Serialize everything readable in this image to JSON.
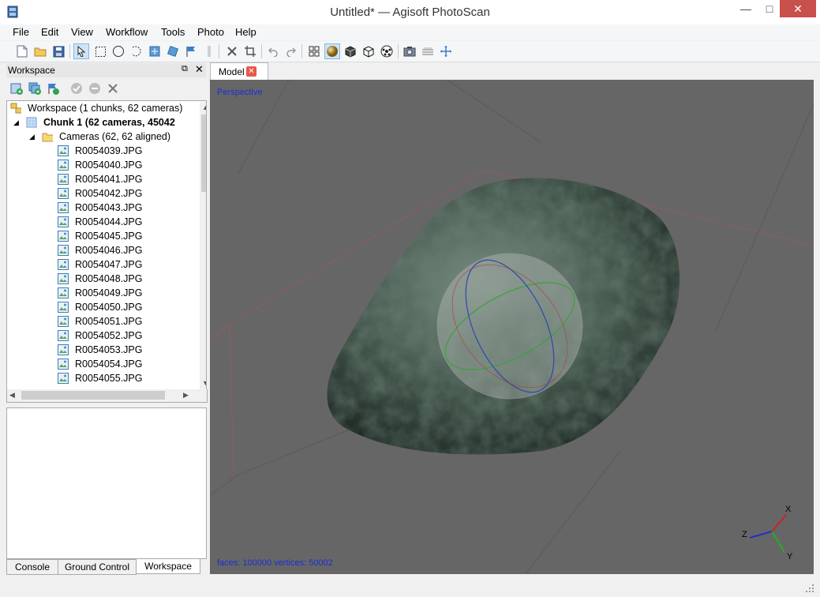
{
  "window": {
    "title": "Untitled* — Agisoft PhotoScan",
    "minimize": "—",
    "maximize": "□",
    "close": "✕"
  },
  "menu": [
    "File",
    "Edit",
    "View",
    "Workflow",
    "Tools",
    "Photo",
    "Help"
  ],
  "toolbar": {
    "icons": [
      "new-icon",
      "open-icon",
      "save-icon",
      "navigation-icon",
      "rectangle-select-icon",
      "circle-select-icon",
      "free-select-icon",
      "resize-region-icon",
      "rotate-region-icon",
      "move-object-icon",
      "delete-icon",
      "crop-icon",
      "undo-icon",
      "redo-icon",
      "point-cloud-icon",
      "shaded-icon",
      "solid-icon",
      "wireframe-icon",
      "textured-icon",
      "show-cameras-icon",
      "show-region-icon",
      "reset-view-icon"
    ]
  },
  "workspace_panel": {
    "title": "Workspace",
    "tools": [
      "add-chunk-icon",
      "add-photos-icon",
      "add-markers-icon",
      "enable-icon",
      "disable-icon",
      "remove-icon"
    ],
    "tree": {
      "workspace_label": "Workspace (1 chunks, 62 cameras)",
      "chunk_label": "Chunk 1 (62 cameras, 45042",
      "cameras_label": "Cameras (62, 62 aligned)",
      "photos": [
        "R0054039.JPG",
        "R0054040.JPG",
        "R0054041.JPG",
        "R0054042.JPG",
        "R0054043.JPG",
        "R0054044.JPG",
        "R0054045.JPG",
        "R0054046.JPG",
        "R0054047.JPG",
        "R0054048.JPG",
        "R0054049.JPG",
        "R0054050.JPG",
        "R0054051.JPG",
        "R0054052.JPG",
        "R0054053.JPG",
        "R0054054.JPG",
        "R0054055.JPG"
      ]
    }
  },
  "bottom_tabs": [
    "Console",
    "Ground Control",
    "Workspace"
  ],
  "model_view": {
    "tab_label": "Model",
    "projection": "Perspective",
    "stats": "faces: 100000 vertices: 50002",
    "axes": {
      "x": "X",
      "y": "Y",
      "z": "Z"
    }
  }
}
